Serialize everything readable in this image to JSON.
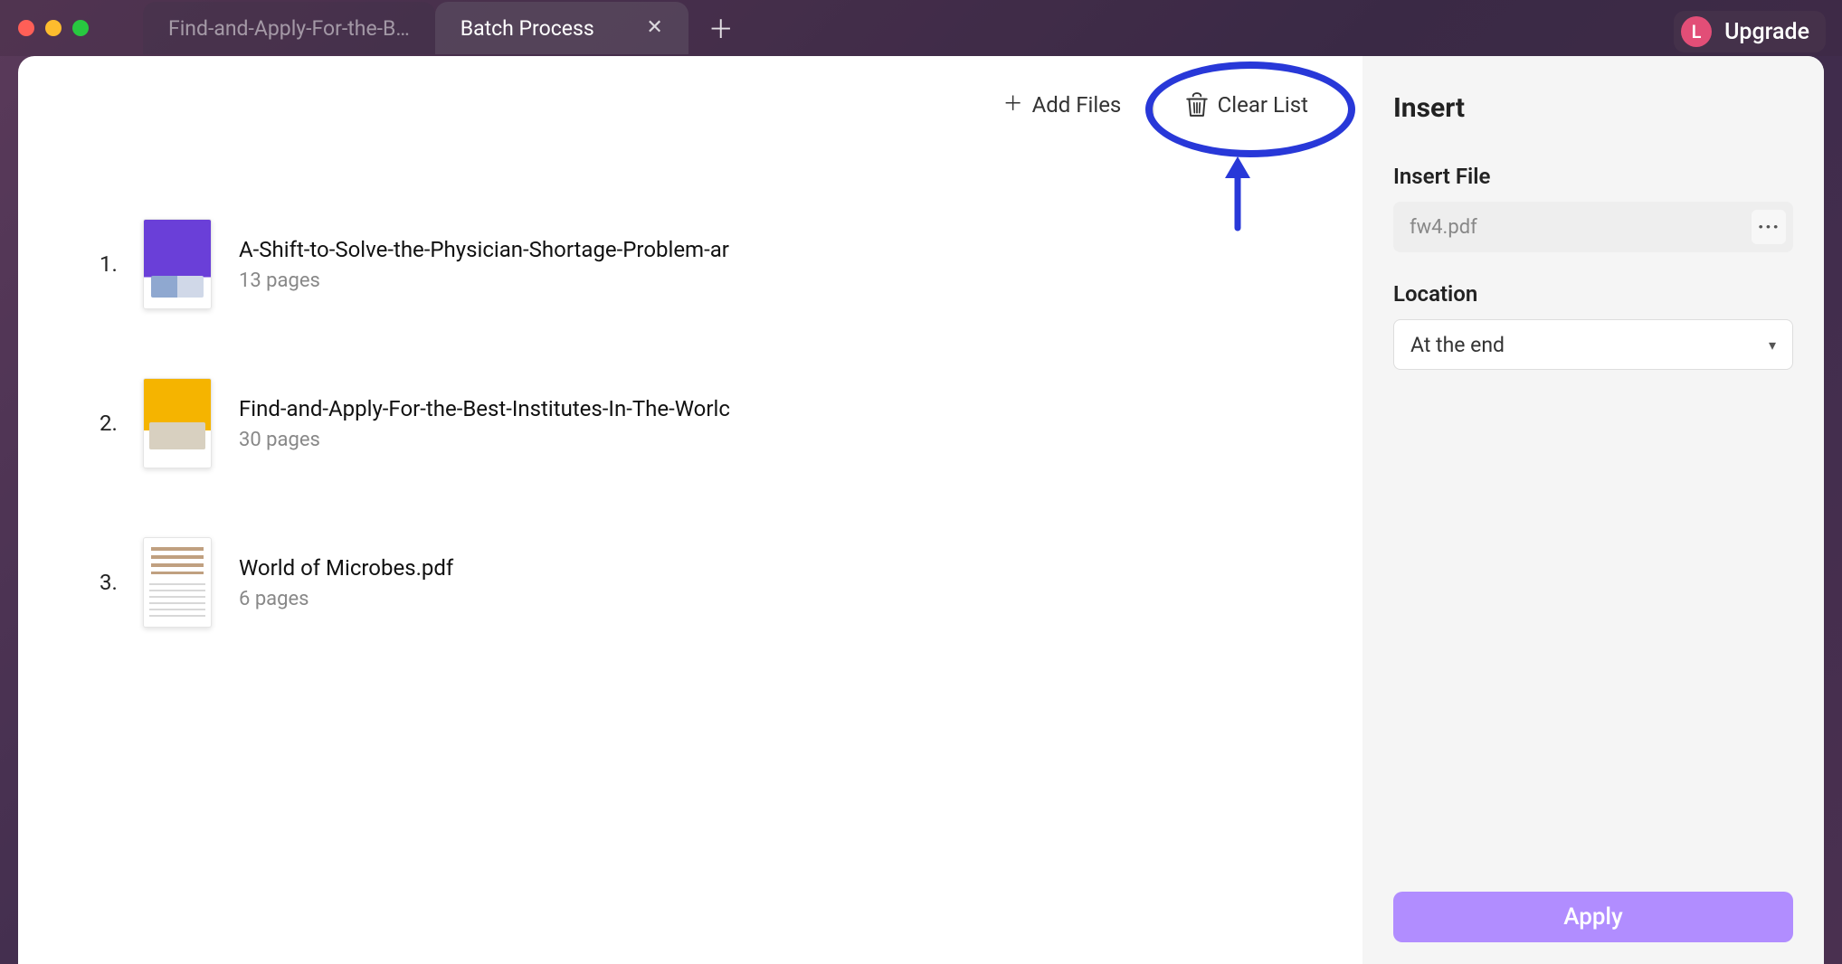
{
  "window": {
    "tabs": [
      {
        "label": "Find-and-Apply-For-the-B…",
        "active": false
      },
      {
        "label": "Batch Process",
        "active": true
      }
    ],
    "upgrade": {
      "avatar_initial": "L",
      "label": "Upgrade"
    }
  },
  "toolbar": {
    "add_files_label": "Add Files",
    "clear_list_label": "Clear List"
  },
  "files": [
    {
      "index": "1.",
      "name": "A-Shift-to-Solve-the-Physician-Shortage-Problem-ar",
      "pages": "13 pages",
      "thumb_style": "purple"
    },
    {
      "index": "2.",
      "name": "Find-and-Apply-For-the-Best-Institutes-In-The-Worlc",
      "pages": "30 pages",
      "thumb_style": "yellow"
    },
    {
      "index": "3.",
      "name": "World of Microbes.pdf",
      "pages": "6 pages",
      "thumb_style": "doc"
    }
  ],
  "sidebar": {
    "title": "Insert",
    "insert_file_label": "Insert File",
    "insert_file_value": "fw4.pdf",
    "location_label": "Location",
    "location_value": "At the end",
    "apply_label": "Apply"
  }
}
